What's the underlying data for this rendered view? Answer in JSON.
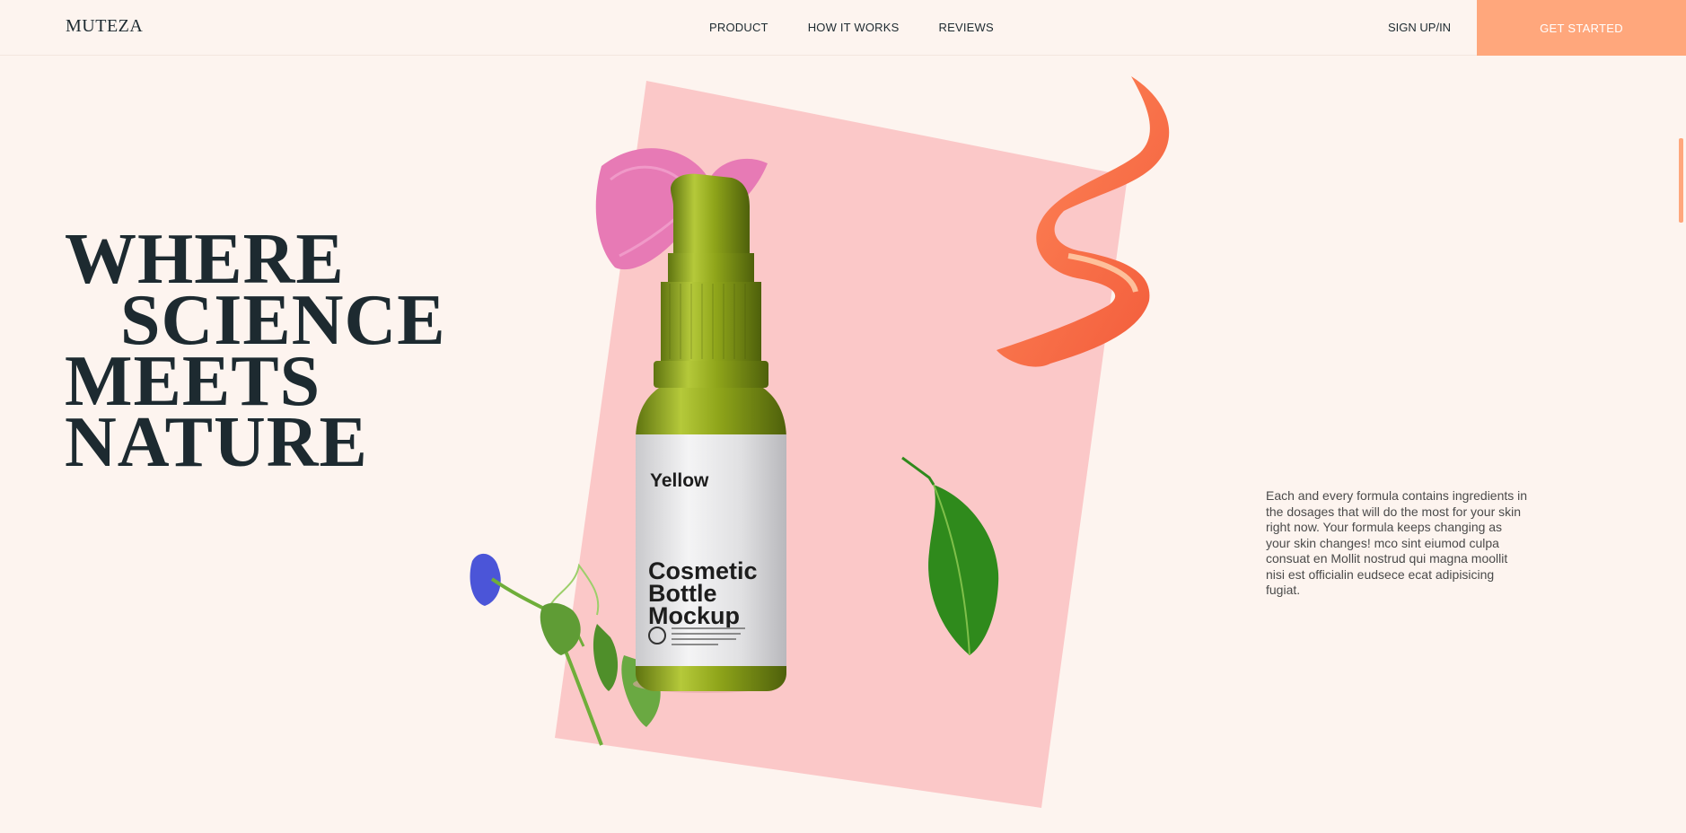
{
  "brand": {
    "logo": "MUTEZA"
  },
  "nav": {
    "items": [
      {
        "label": "PRODUCT"
      },
      {
        "label": "HOW IT WORKS"
      },
      {
        "label": "REVIEWS"
      }
    ],
    "signin": "SIGN UP/IN",
    "cta": "GET STARTED"
  },
  "hero": {
    "headline": [
      "WHERE",
      "SCIENCE",
      "MEETS",
      "NATURE"
    ],
    "bottle": {
      "label_top": "Yellow",
      "label_main": [
        "Cosmetic",
        "Bottle",
        "Mockup"
      ]
    },
    "description": "Each and every formula contains ingredients in the dosages that will do the most for your skin right now. Your formula keeps changing as your skin changes! mco sint eiumod culpa consuat en Mollit nostrud qui magna moollit nisi est officialin eudsece ecat adipisicing fugiat."
  },
  "colors": {
    "background": "#fdf4ef",
    "accent": "#ffa77c",
    "text": "#1d2a30",
    "panel": "#fbc8c8",
    "bottle": "#8fa51a"
  },
  "icons": [
    "rose-petal-icon",
    "orange-peel-icon",
    "leaf-icon",
    "blue-flower-icon"
  ]
}
